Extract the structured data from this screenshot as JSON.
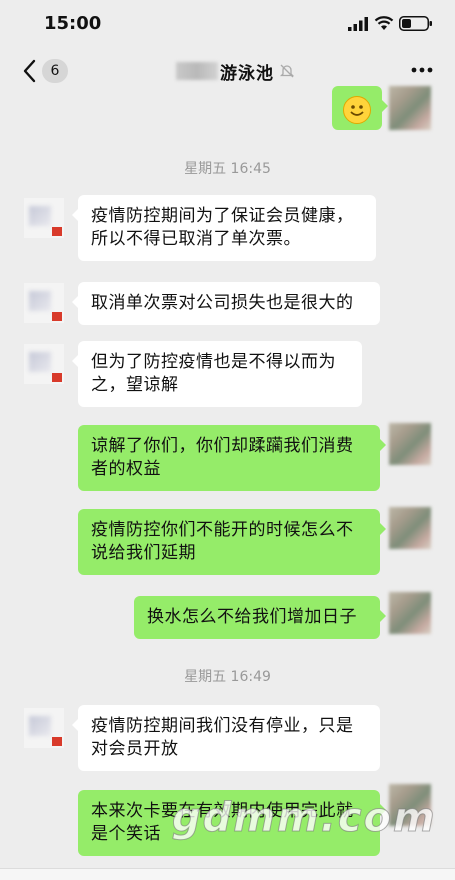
{
  "status_bar": {
    "time": "15:00"
  },
  "header": {
    "unread_count": "6",
    "title": "游泳池"
  },
  "messages": [
    {
      "time": "星期五 16:45"
    },
    {
      "from": "other",
      "text": "疫情防控期间为了保证会员健康，所以不得已取消了单次票。"
    },
    {
      "from": "other",
      "text": "取消单次票对公司损失也是很大的"
    },
    {
      "from": "other",
      "text": "但为了防控疫情也是不得以而为之，望谅解"
    },
    {
      "from": "me",
      "text": "谅解了你们，你们却蹂躏我们消费者的权益"
    },
    {
      "from": "me",
      "text": "疫情防控你们不能开的时候怎么不说给我们延期"
    },
    {
      "from": "me",
      "text": "换水怎么不给我们增加日子"
    },
    {
      "time": "星期五 16:49"
    },
    {
      "from": "other",
      "text": "疫情防控期间我们没有停业，只是对会员开放"
    },
    {
      "from": "me",
      "text": "本来次卡要在有效期内使用完此就是个笑话"
    }
  ],
  "watermark": "gdmm.com",
  "colors": {
    "background": "#ededed",
    "outgoing_bubble": "#95ec69",
    "incoming_bubble": "#ffffff"
  },
  "icons": [
    "signal-icon",
    "wifi-icon",
    "battery-icon",
    "back-arrow-icon",
    "mute-bell-icon",
    "more-icon",
    "smile-emoji-icon"
  ]
}
